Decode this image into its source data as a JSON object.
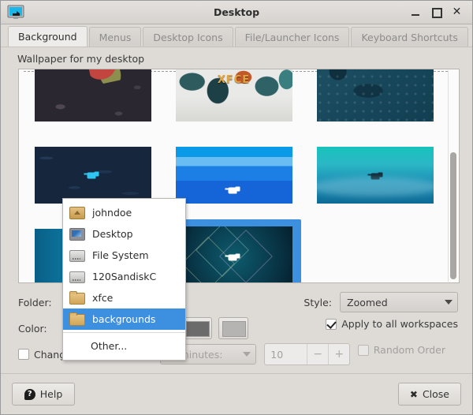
{
  "window": {
    "title": "Desktop",
    "icon": "desktop-monitor-icon",
    "buttons": {
      "minimize": "minimize-icon",
      "maximize": "maximize-icon",
      "close": "✕"
    }
  },
  "tabs": [
    {
      "label": "Background",
      "active": true
    },
    {
      "label": "Menus",
      "active": false
    },
    {
      "label": "Desktop Icons",
      "active": false
    },
    {
      "label": "File/Launcher Icons",
      "active": false
    },
    {
      "label": "Keyboard Shortcuts",
      "active": false
    }
  ],
  "main": {
    "section_label": "Wallpaper for my desktop",
    "wallpapers": [
      {
        "name": "flower-dark-wallpaper",
        "selected": false
      },
      {
        "name": "xfce-paint-wallpaper",
        "selected": false,
        "caption": "XFCE"
      },
      {
        "name": "dragon-blue-wallpaper",
        "selected": false
      },
      {
        "name": "dark-navy-mouse-wallpaper",
        "selected": false
      },
      {
        "name": "blue-stripes-mouse-wallpaper",
        "selected": false
      },
      {
        "name": "teal-horizon-wallpaper",
        "selected": false
      },
      {
        "name": "blue-gradient-wallpaper",
        "selected": false
      },
      {
        "name": "diamond-mouse-wallpaper",
        "selected": true
      },
      {
        "name": "empty-slot",
        "selected": false
      }
    ]
  },
  "options": {
    "folder_label": "Folder:",
    "folder_value": "backgrounds",
    "color_label": "Color:",
    "style_label": "Style:",
    "style_value": "Zoomed",
    "apply_all_label": "Apply to all workspaces",
    "apply_all_checked": true,
    "change_background_label": "Change the background",
    "change_background_checked": false,
    "period_value": "in minutes:",
    "interval_value": "10",
    "minus_label": "−",
    "plus_label": "+",
    "random_order_label": "Random Order",
    "random_order_checked": false,
    "swatch_dark_color": "#6b6b6b",
    "swatch_light_color": "#b6b4b2"
  },
  "menu": {
    "items": [
      {
        "label": "johndoe",
        "icon": "home-folder-icon",
        "selected": false,
        "separator_after": false
      },
      {
        "label": "Desktop",
        "icon": "desktop-icon",
        "selected": false,
        "separator_after": false
      },
      {
        "label": "File System",
        "icon": "drive-icon",
        "selected": false,
        "separator_after": false
      },
      {
        "label": "120SandiskC",
        "icon": "drive-icon",
        "selected": false,
        "separator_after": false
      },
      {
        "label": "xfce",
        "icon": "folder-icon",
        "selected": false,
        "separator_after": false
      },
      {
        "label": "backgrounds",
        "icon": "folder-icon",
        "selected": true,
        "separator_after": true
      },
      {
        "label": "Other...",
        "icon": "none",
        "selected": false,
        "separator_after": false
      }
    ]
  },
  "footer": {
    "help_label": "Help",
    "help_glyph": "?",
    "close_label": "Close",
    "close_glyph": "✖"
  },
  "colors": {
    "accent": "#3d8fe0",
    "window_bg": "#dedbd7",
    "panel_bg": "#fbfbfb"
  }
}
